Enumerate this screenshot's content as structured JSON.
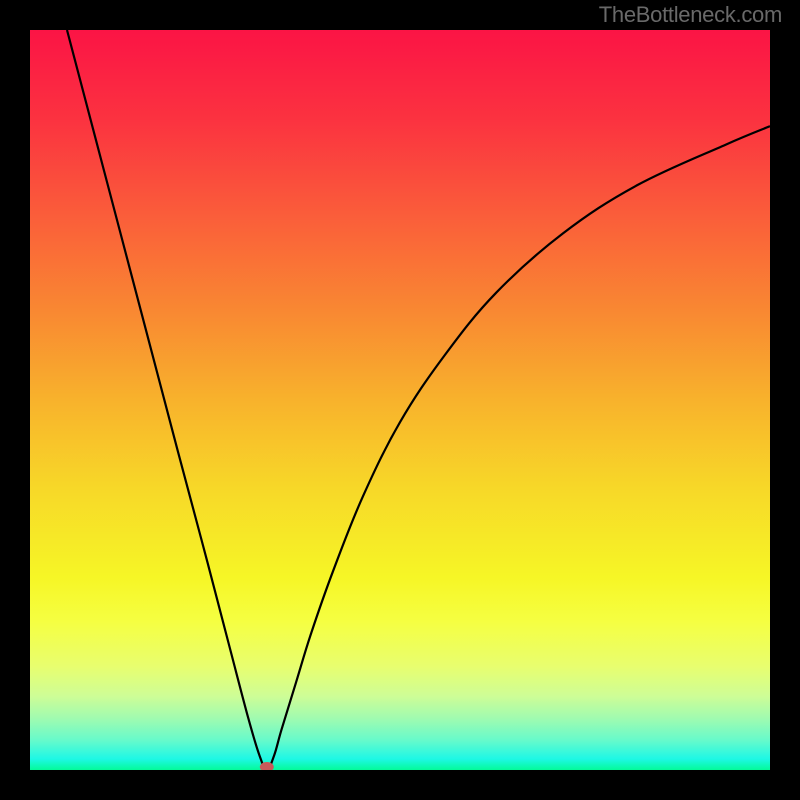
{
  "watermark": "TheBottleneck.com",
  "chart_data": {
    "type": "line",
    "title": "",
    "xlabel": "",
    "ylabel": "",
    "x_range": [
      0,
      100
    ],
    "y_range": [
      0,
      100
    ],
    "series": [
      {
        "name": "bottleneck-curve",
        "description": "V-shaped bottleneck curve with sharp minimum near x≈32",
        "x": [
          5,
          10,
          15,
          20,
          24,
          27,
          29.5,
          31,
          32,
          33,
          34,
          36,
          38,
          41,
          45,
          50,
          56,
          63,
          72,
          82,
          94,
          100
        ],
        "y": [
          100,
          81,
          62,
          43,
          28,
          16.5,
          7,
          2,
          0,
          2,
          5.5,
          12,
          18.5,
          27,
          37,
          47,
          56,
          64.5,
          72.5,
          79,
          84.5,
          87
        ]
      }
    ],
    "marker": {
      "x": 32,
      "y": 0,
      "color": "#c85a5a"
    },
    "background_gradient": {
      "type": "vertical",
      "stops": [
        {
          "pos": 0.0,
          "color": "#fb1445"
        },
        {
          "pos": 0.12,
          "color": "#fb3240"
        },
        {
          "pos": 0.25,
          "color": "#fa5d3a"
        },
        {
          "pos": 0.38,
          "color": "#f98832"
        },
        {
          "pos": 0.5,
          "color": "#f8b22c"
        },
        {
          "pos": 0.62,
          "color": "#f7d828"
        },
        {
          "pos": 0.74,
          "color": "#f6f626"
        },
        {
          "pos": 0.8,
          "color": "#f5ff42"
        },
        {
          "pos": 0.86,
          "color": "#e8fe6f"
        },
        {
          "pos": 0.9,
          "color": "#cefd96"
        },
        {
          "pos": 0.93,
          "color": "#a0fbb0"
        },
        {
          "pos": 0.96,
          "color": "#66facb"
        },
        {
          "pos": 0.985,
          "color": "#1ef8e5"
        },
        {
          "pos": 1.0,
          "color": "#03fa98"
        }
      ]
    }
  }
}
